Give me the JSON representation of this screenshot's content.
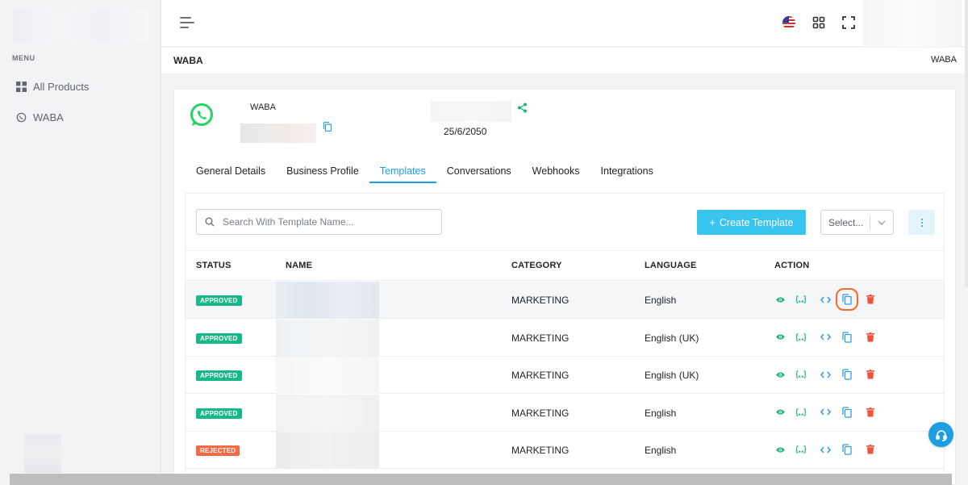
{
  "sidebar": {
    "menu_label": "MENU",
    "items": [
      {
        "label": "All Products",
        "icon": "grid-icon"
      },
      {
        "label": "WABA",
        "icon": "whatsapp-icon"
      }
    ]
  },
  "topbar": {
    "icons": [
      "hamburger-icon",
      "us-flag-icon",
      "apps-grid-icon",
      "fullscreen-icon"
    ]
  },
  "breadcrumb": {
    "title": "WABA",
    "current": "WABA"
  },
  "account": {
    "name": "WABA",
    "date": "25/6/2050"
  },
  "tabs": [
    {
      "label": "General Details",
      "active": false
    },
    {
      "label": "Business Profile",
      "active": false
    },
    {
      "label": "Templates",
      "active": true
    },
    {
      "label": "Conversations",
      "active": false
    },
    {
      "label": "Webhooks",
      "active": false
    },
    {
      "label": "Integrations",
      "active": false
    }
  ],
  "toolbar": {
    "search_placeholder": "Search With Template Name...",
    "create_label": "Create Template",
    "create_icon": "+",
    "select_value": "Select..."
  },
  "table": {
    "headers": {
      "status": "STATUS",
      "name": "NAME",
      "category": "CATEGORY",
      "language": "LANGUAGE",
      "action": "ACTION"
    },
    "rows": [
      {
        "status": "APPROVED",
        "category": "MARKETING",
        "language": "English"
      },
      {
        "status": "APPROVED",
        "category": "MARKETING",
        "language": "English (UK)"
      },
      {
        "status": "APPROVED",
        "category": "MARKETING",
        "language": "English (UK)"
      },
      {
        "status": "APPROVED",
        "category": "MARKETING",
        "language": "English"
      },
      {
        "status": "REJECTED",
        "category": "MARKETING",
        "language": "English"
      }
    ],
    "action_icons": [
      "eye-icon",
      "json-braces-icon",
      "code-icon",
      "copy-icon",
      "trash-icon"
    ]
  },
  "colors": {
    "accent": "#1e9ee0",
    "create_button": "#38c4ee",
    "approved": "#18b888",
    "rejected": "#f26a46",
    "action_green": "#1fb37d",
    "action_blue": "#2d9fe0",
    "delete_red": "#f0533b",
    "whatsapp": "#25d366"
  }
}
